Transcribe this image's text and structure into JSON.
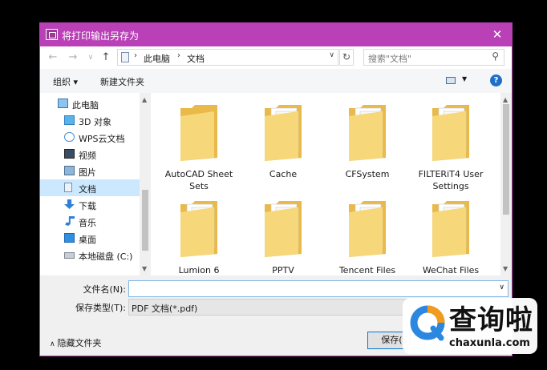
{
  "window": {
    "title": "将打印输出另存为",
    "close_glyph": "✕"
  },
  "nav": {
    "back_glyph": "←",
    "forward_glyph": "→",
    "recent_glyph": "∨",
    "up_glyph": "↑",
    "breadcrumbs": [
      "此电脑",
      "文档"
    ],
    "separator": "›",
    "refresh_glyph": "↻",
    "search_placeholder": "搜索\"文档\""
  },
  "toolbar": {
    "organize_label": "组织 ▾",
    "new_folder_label": "新建文件夹",
    "help_label": "?"
  },
  "sidebar": {
    "items": [
      {
        "label": "此电脑",
        "icon": "computer-icon",
        "indent": 1,
        "selected": false
      },
      {
        "label": "3D 对象",
        "icon": "cube-3d-icon",
        "indent": 2,
        "selected": false
      },
      {
        "label": "WPS云文档",
        "icon": "cloud-icon",
        "indent": 2,
        "selected": false
      },
      {
        "label": "视频",
        "icon": "video-icon",
        "indent": 2,
        "selected": false
      },
      {
        "label": "图片",
        "icon": "picture-icon",
        "indent": 2,
        "selected": false
      },
      {
        "label": "文档",
        "icon": "document-icon",
        "indent": 2,
        "selected": true
      },
      {
        "label": "下载",
        "icon": "download-icon",
        "indent": 2,
        "selected": false
      },
      {
        "label": "音乐",
        "icon": "music-icon",
        "indent": 2,
        "selected": false
      },
      {
        "label": "桌面",
        "icon": "desktop-icon",
        "indent": 2,
        "selected": false
      },
      {
        "label": "本地磁盘 (C:)",
        "icon": "drive-icon",
        "indent": 2,
        "selected": false
      }
    ]
  },
  "folders": [
    {
      "name": "AutoCAD Sheet Sets",
      "has_files": false
    },
    {
      "name": "Cache",
      "has_files": true
    },
    {
      "name": "CFSystem",
      "has_files": true
    },
    {
      "name": "FILTERiT4 User Settings",
      "has_files": true
    },
    {
      "name": "Lumion 6",
      "has_files": true
    },
    {
      "name": "PPTV",
      "has_files": true
    },
    {
      "name": "Tencent Files",
      "has_files": true
    },
    {
      "name": "WeChat Files",
      "has_files": true
    }
  ],
  "form": {
    "filename_label": "文件名(N):",
    "filename_value": "",
    "filetype_label": "保存类型(T):",
    "filetype_value": "PDF 文档(*.pdf)",
    "hide_folders_label": "隐藏文件夹",
    "save_label": "保存(S)",
    "cancel_label": ""
  },
  "watermark": {
    "big": "查询啦",
    "small": "chaxunla.com"
  },
  "colors": {
    "titlebar": "#b940b6",
    "selection": "#cce8ff",
    "folder": "#f4cf6a",
    "accent": "#0078d7",
    "watermark_blue": "#2b87e0",
    "watermark_orange": "#f29a1b"
  }
}
